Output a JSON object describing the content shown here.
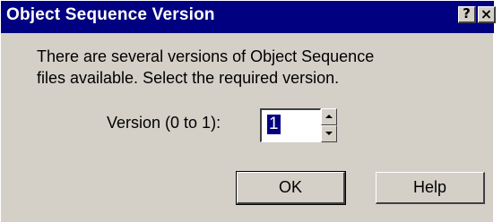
{
  "window": {
    "title": "Object Sequence Version",
    "help_caption": "?",
    "close_caption": "×"
  },
  "message": {
    "line1": "There are several versions of Object Sequence",
    "line2": "files available. Select the required version."
  },
  "version_field": {
    "label": "Version (0 to 1):",
    "value": "1"
  },
  "buttons": {
    "ok_label": "OK",
    "help_label": "Help"
  },
  "colors": {
    "titlebar": "#000080",
    "dialog_face": "#d4d0c8"
  }
}
